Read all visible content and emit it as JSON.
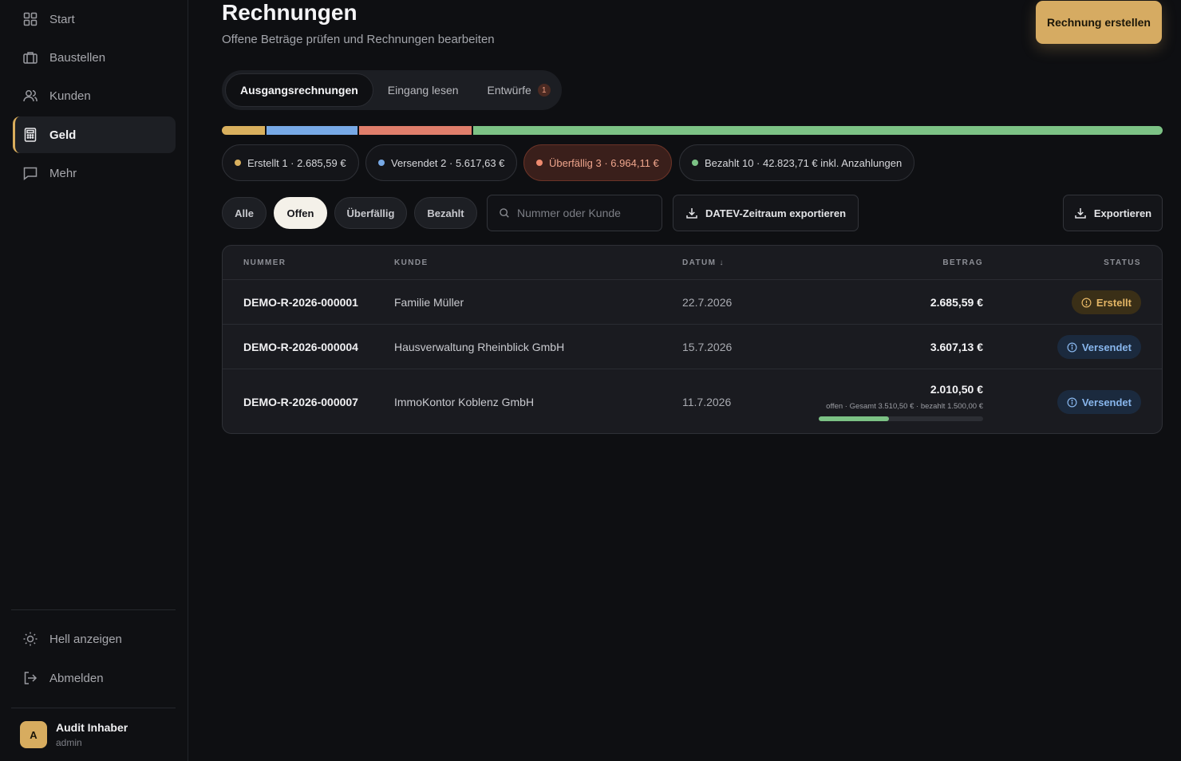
{
  "sidebar": {
    "items": [
      {
        "label": "Start",
        "icon": "grid-icon"
      },
      {
        "label": "Baustellen",
        "icon": "briefcase-icon"
      },
      {
        "label": "Kunden",
        "icon": "users-icon"
      },
      {
        "label": "Geld",
        "icon": "calculator-icon",
        "active": true
      },
      {
        "label": "Mehr",
        "icon": "chat-icon"
      }
    ],
    "bottom": [
      {
        "label": "Hell anzeigen",
        "icon": "sun-icon"
      },
      {
        "label": "Abmelden",
        "icon": "logout-icon"
      }
    ],
    "user": {
      "initial": "A",
      "name": "Audit Inhaber",
      "role": "admin"
    }
  },
  "header": {
    "title": "Rechnungen",
    "subtitle": "Offene Beträge prüfen und Rechnungen bearbeiten",
    "create_label": "Rechnung erstellen"
  },
  "tabs": [
    {
      "label": "Ausgangsrechnungen",
      "active": true
    },
    {
      "label": "Eingang lesen"
    },
    {
      "label": "Entwürfe",
      "badge": "1"
    }
  ],
  "status_bar": [
    {
      "status": "Erstellt",
      "share": 0.046,
      "color": "#d9b05e"
    },
    {
      "status": "Versendet",
      "share": 0.097,
      "color": "#77a9e6"
    },
    {
      "status": "Überfällig",
      "share": 0.12,
      "color": "#e07e6b"
    },
    {
      "status": "Bezahlt",
      "share": 0.737,
      "color": "#7cc285"
    }
  ],
  "summary": [
    {
      "label": "Erstellt 1 · 2.685,59 €",
      "color": "#d9b05e"
    },
    {
      "label": "Versendet 2 · 5.617,63 €",
      "color": "#77a9e6"
    },
    {
      "label": "Überfällig 3 · 6.964,11 €",
      "color": "#ef8a6f"
    },
    {
      "label": "Bezahlt 10 · 42.823,71 € inkl. Anzahlungen",
      "color": "#7cc285"
    }
  ],
  "filters": [
    {
      "label": "Alle"
    },
    {
      "label": "Offen",
      "active": true
    },
    {
      "label": "Überfällig"
    },
    {
      "label": "Bezahlt"
    }
  ],
  "search": {
    "placeholder": "Nummer oder Kunde"
  },
  "datev_label": "DATEV-Zeitraum exportieren",
  "export_label": "Exportieren",
  "table": {
    "headers": {
      "nummer": "NUMMER",
      "kunde": "KUNDE",
      "datum": "DATUM ↓",
      "betrag": "BETRAG",
      "status": "STATUS"
    },
    "rows": [
      {
        "nummer": "DEMO-R-2026-000001",
        "kunde": "Familie Müller",
        "datum": "22.7.2026",
        "betrag": "2.685,59 €",
        "status": "Erstellt"
      },
      {
        "nummer": "DEMO-R-2026-000004",
        "kunde": "Hausverwaltung Rheinblick GmbH",
        "datum": "15.7.2026",
        "betrag": "3.607,13 €",
        "status": "Versendet"
      },
      {
        "nummer": "DEMO-R-2026-000007",
        "kunde": "ImmoKontor Koblenz GmbH",
        "datum": "11.7.2026",
        "betrag": "2.010,50 €",
        "status": "Versendet",
        "note": "offen · Gesamt 3.510,50 € · bezahlt 1.500,00 €",
        "paid_fraction": 0.427
      }
    ]
  }
}
